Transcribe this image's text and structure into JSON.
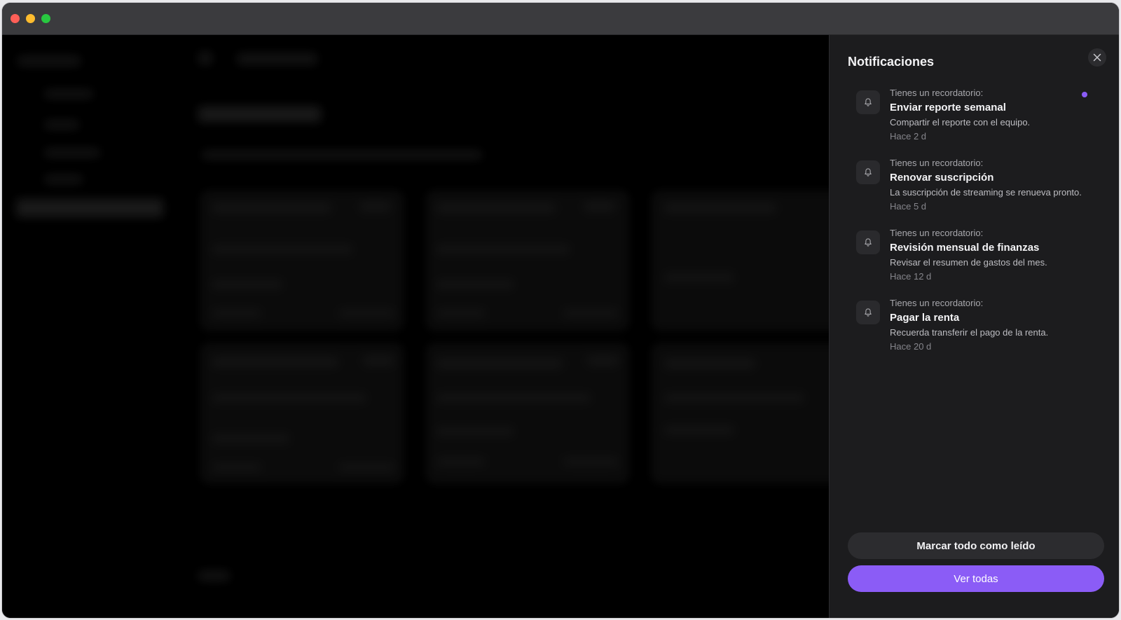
{
  "colors": {
    "accent": "#8b5cf6",
    "traffic_close": "#ff5f57",
    "traffic_minimize": "#febc2e",
    "traffic_zoom": "#28c840"
  },
  "panel": {
    "title": "Notificaciones",
    "close_icon": "close-icon",
    "notifications": [
      {
        "prefix": "Tienes un recordatorio:",
        "title": "Enviar reporte semanal",
        "body": "Compartir el reporte con el equipo.",
        "time": "Hace 2 d",
        "unread": true,
        "icon": "bell-icon"
      },
      {
        "prefix": "Tienes un recordatorio:",
        "title": "Renovar suscripción",
        "body": "La suscripción de streaming se renueva pronto.",
        "time": "Hace 5 d",
        "unread": false,
        "icon": "bell-icon"
      },
      {
        "prefix": "Tienes un recordatorio:",
        "title": "Revisión mensual de finanzas",
        "body": "Revisar el resumen de gastos del mes.",
        "time": "Hace 12 d",
        "unread": false,
        "icon": "bell-icon"
      },
      {
        "prefix": "Tienes un recordatorio:",
        "title": "Pagar la renta",
        "body": "Recuerda transferir el pago de la renta.",
        "time": "Hace 20 d",
        "unread": false,
        "icon": "bell-icon"
      }
    ],
    "mark_all_read": "Marcar todo como leído",
    "view_all": "Ver todas"
  }
}
